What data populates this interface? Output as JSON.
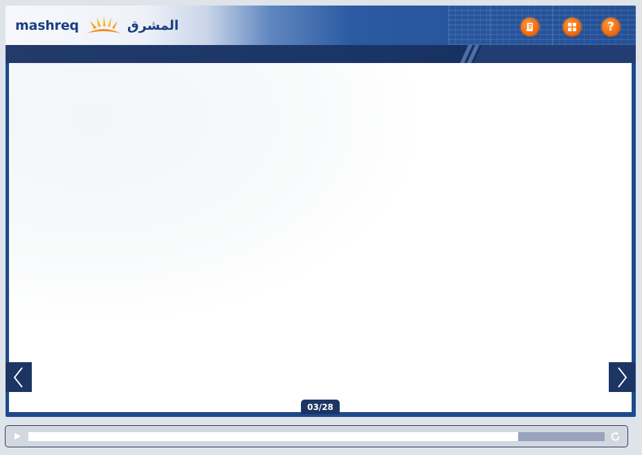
{
  "header": {
    "logo_latin": "mashreq",
    "logo_arabic": "المشرق",
    "buttons": [
      {
        "name": "transcript-button",
        "icon": "document-icon"
      },
      {
        "name": "menu-button",
        "icon": "grid-icon"
      },
      {
        "name": "help-button",
        "icon": "question-icon",
        "glyph": "?"
      }
    ]
  },
  "navigation": {
    "prev_icon": "chevron-left-icon",
    "next_icon": "chevron-right-icon",
    "page_counter": "03/28"
  },
  "player": {
    "play_icon": "play-icon",
    "replay_icon": "replay-icon",
    "progress": 0.85
  },
  "colors": {
    "accent_orange": "#f26b0f",
    "navy": "#1c3563",
    "brand_blue": "#1b3f80"
  }
}
